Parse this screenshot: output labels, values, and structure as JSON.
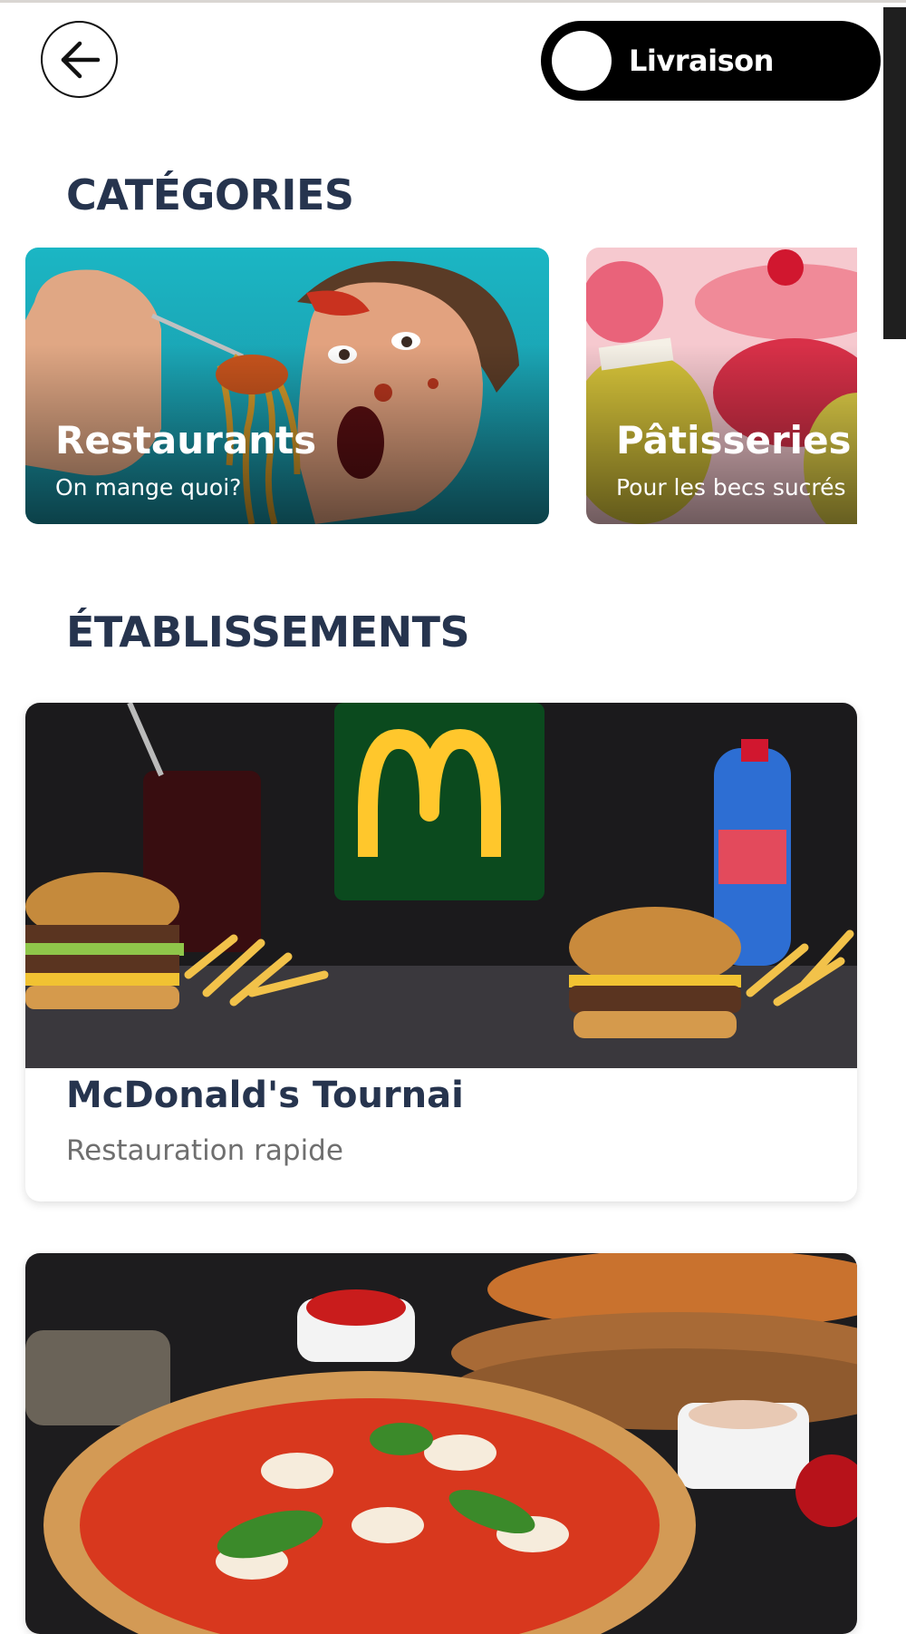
{
  "header": {
    "back_icon": "arrow-left-icon",
    "toggle_label": "Livraison"
  },
  "categories": {
    "title": "CATÉGORIES",
    "items": [
      {
        "label": "Restaurants",
        "subtitle": "On mange quoi?"
      },
      {
        "label": "Pâtisseries",
        "subtitle": "Pour les becs sucrés"
      }
    ]
  },
  "establishments": {
    "title": "ÉTABLISSEMENTS",
    "items": [
      {
        "name": "McDonald's Tournai",
        "type": "Restauration rapide"
      }
    ]
  },
  "colors": {
    "heading": "#26344e",
    "toggle_bg": "#000000",
    "mcdonalds_green": "#0b4a1e",
    "mcdonalds_yellow": "#ffc72c"
  }
}
